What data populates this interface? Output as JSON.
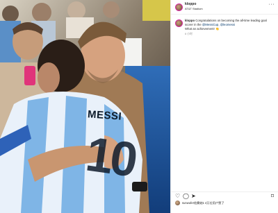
{
  "photo": {
    "jersey_name": "MESSI",
    "jersey_number": "10"
  },
  "post": {
    "username": "kloppo",
    "location": "AT&T Stadium",
    "more_icon": "more-horizontal-icon",
    "caption": {
      "author": "kloppo",
      "text_1": "Congratulations on becoming the all-time leading goal scorer in the",
      "tag_1": "@MessiCup",
      "sep": ",",
      "tag_2": "@leomessi",
      "text_2": "What an achievement! 👏"
    },
    "time": "6 小时"
  },
  "actions": {
    "like_icon": "heart-icon",
    "comment_icon": "comment-icon",
    "share_icon": "share-icon",
    "save_icon": "bookmark-icon"
  },
  "liked_by": "sunwufer佑賽她1 4万位用户赞了"
}
